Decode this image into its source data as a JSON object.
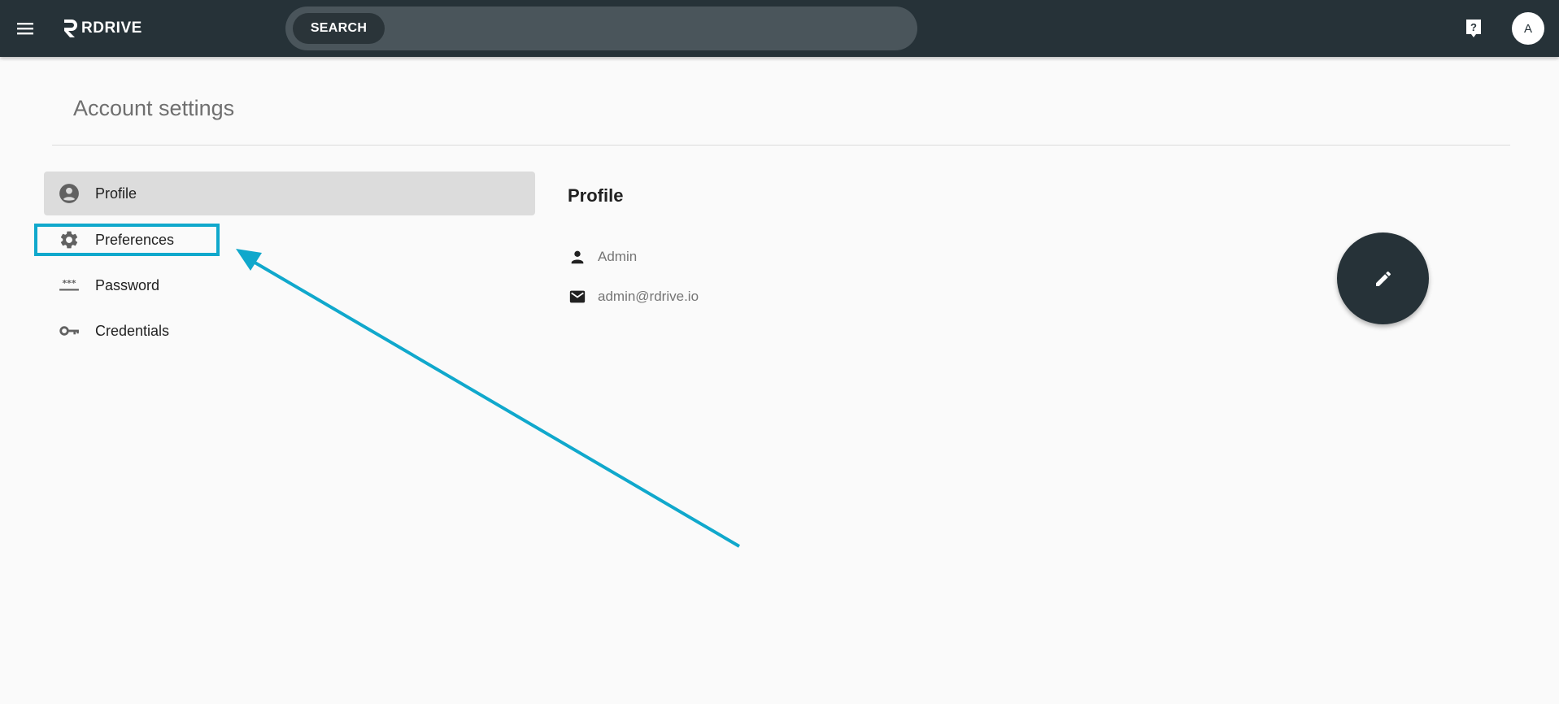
{
  "header": {
    "logo_text": "RDRIVE",
    "search_label": "SEARCH",
    "search_placeholder": "",
    "avatar_letter": "A",
    "menu_icon": "hamburger-menu-icon",
    "help_icon": "help-icon"
  },
  "page": {
    "title": "Account settings"
  },
  "sidebar": {
    "items": [
      {
        "label": "Profile",
        "icon": "account-circle-icon",
        "active": true
      },
      {
        "label": "Preferences",
        "icon": "gear-icon",
        "active": false
      },
      {
        "label": "Password",
        "icon": "password-icon",
        "active": false
      },
      {
        "label": "Credentials",
        "icon": "key-icon",
        "active": false
      }
    ]
  },
  "profile": {
    "title": "Profile",
    "name": "Admin",
    "email": "admin@rdrive.io",
    "edit_icon": "pencil-icon"
  },
  "colors": {
    "topbar": "#263238",
    "search_bg": "#4a555b",
    "highlight": "#10a8cc",
    "active_item": "#dcdcdc"
  }
}
